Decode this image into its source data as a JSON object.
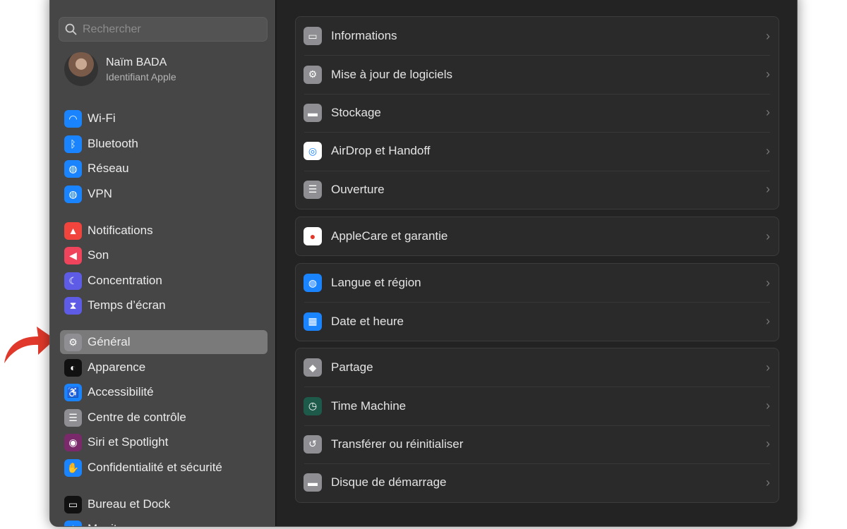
{
  "sidebar": {
    "search_placeholder": "Rechercher",
    "profile": {
      "name": "Naïm BADA",
      "subtitle": "Identifiant Apple"
    },
    "items": [
      {
        "label": "Wi-Fi",
        "icon": "wifi-icon",
        "color": "#1a84ff"
      },
      {
        "label": "Bluetooth",
        "icon": "bluetooth-icon",
        "color": "#1a84ff"
      },
      {
        "label": "Réseau",
        "icon": "globe-icon",
        "color": "#1a84ff"
      },
      {
        "label": "VPN",
        "icon": "vpn-globe-icon",
        "color": "#1a84ff"
      },
      {
        "label": "Notifications",
        "icon": "bell-icon",
        "color": "#f0443c"
      },
      {
        "label": "Son",
        "icon": "speaker-icon",
        "color": "#f0445c"
      },
      {
        "label": "Concentration",
        "icon": "moon-icon",
        "color": "#5e5ce6"
      },
      {
        "label": "Temps d’écran",
        "icon": "hourglass-icon",
        "color": "#5e5ce6"
      },
      {
        "label": "Général",
        "icon": "gear-icon",
        "color": "#8e8e93",
        "selected": true
      },
      {
        "label": "Apparence",
        "icon": "appearance-icon",
        "color": "#111111"
      },
      {
        "label": "Accessibilité",
        "icon": "accessibility-icon",
        "color": "#1a84ff"
      },
      {
        "label": "Centre de contrôle",
        "icon": "toggles-icon",
        "color": "#8e8e93"
      },
      {
        "label": "Siri et Spotlight",
        "icon": "siri-icon",
        "color": "#7a2a6a"
      },
      {
        "label": "Confidentialité et sécurité",
        "icon": "hand-icon",
        "color": "#1a84ff"
      },
      {
        "label": "Bureau et Dock",
        "icon": "dock-icon",
        "color": "#111111"
      },
      {
        "label": "Moniteurs",
        "icon": "sun-icon",
        "color": "#1a84ff"
      }
    ]
  },
  "main": {
    "groups": [
      [
        {
          "label": "Informations",
          "icon": "laptop-icon",
          "color": "#8e8e93"
        },
        {
          "label": "Mise à jour de logiciels",
          "icon": "gear-badge-icon",
          "color": "#8e8e93"
        },
        {
          "label": "Stockage",
          "icon": "drive-icon",
          "color": "#8e8e93"
        },
        {
          "label": "AirDrop et Handoff",
          "icon": "airdrop-icon",
          "color": "#ffffff"
        },
        {
          "label": "Ouverture",
          "icon": "list-icon",
          "color": "#8e8e93"
        }
      ],
      [
        {
          "label": "AppleCare et garantie",
          "icon": "apple-icon",
          "color": "#ffffff"
        }
      ],
      [
        {
          "label": "Langue et région",
          "icon": "globe-icon",
          "color": "#1a84ff"
        },
        {
          "label": "Date et heure",
          "icon": "calendar-clock-icon",
          "color": "#1a84ff"
        }
      ],
      [
        {
          "label": "Partage",
          "icon": "sharing-icon",
          "color": "#8e8e93"
        },
        {
          "label": "Time Machine",
          "icon": "time-machine-icon",
          "color": "#1d5a4a"
        },
        {
          "label": "Transférer ou réinitialiser",
          "icon": "reset-icon",
          "color": "#8e8e93"
        },
        {
          "label": "Disque de démarrage",
          "icon": "disk-icon",
          "color": "#8e8e93"
        }
      ]
    ]
  },
  "annotation": {
    "arrow_color": "#e0392b"
  }
}
